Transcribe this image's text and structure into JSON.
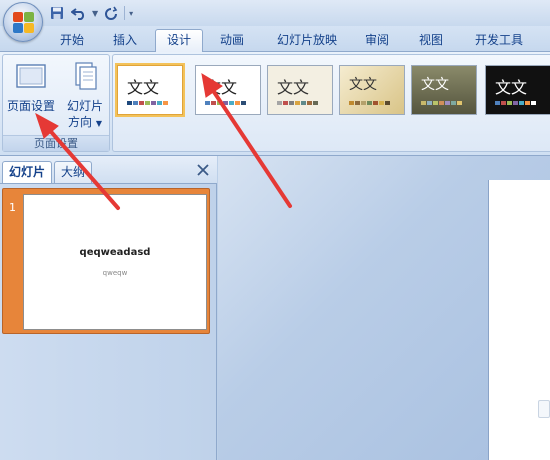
{
  "ribbon": {
    "tabs": [
      {
        "label": "开始",
        "active": false
      },
      {
        "label": "插入",
        "active": false
      },
      {
        "label": "设计",
        "active": true
      },
      {
        "label": "动画",
        "active": false
      },
      {
        "label": "幻灯片放映",
        "active": false
      },
      {
        "label": "审阅",
        "active": false
      },
      {
        "label": "视图",
        "active": false
      },
      {
        "label": "开发工具",
        "active": false
      }
    ],
    "page_setup_group": {
      "page_setup_label": "页面设置",
      "orientation_label_line1": "幻灯片",
      "orientation_label_line2": "方向",
      "group_label": "页面设置"
    },
    "themes": [
      {
        "label": "文文",
        "bg": "#ffffff",
        "text_color": "#222222"
      },
      {
        "label": "文文",
        "bg": "#ffffff",
        "text_color": "#222222"
      },
      {
        "label": "文文",
        "bg": "#f3efe2",
        "text_color": "#333333"
      },
      {
        "label": "文文",
        "bg": "#e9d9a8",
        "text_color": "#333333"
      },
      {
        "label": "文文",
        "bg": "#6b6b50",
        "text_color": "#ffffff"
      },
      {
        "label": "文文",
        "bg": "#111111",
        "text_color": "#ffffff"
      }
    ],
    "selected_theme_index": 0
  },
  "slide_panel": {
    "tab_slides": "幻灯片",
    "tab_outline": "大纲",
    "slides": [
      {
        "number": "1",
        "title": "qeqweadasd",
        "subtitle": "qweqw"
      }
    ]
  },
  "colors": {
    "accent": "#15428b",
    "annotation_arrow": "#e53935",
    "slide_selection": "#e7853a"
  },
  "icons": [
    "office-button-icon",
    "save-icon",
    "undo-icon",
    "redo-icon",
    "page-setup-icon",
    "slide-orientation-icon",
    "close-icon"
  ]
}
